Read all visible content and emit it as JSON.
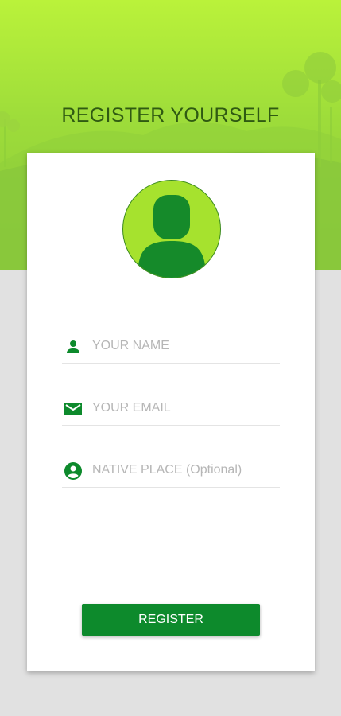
{
  "header": {
    "title": "REGISTER YOURSELF"
  },
  "form": {
    "name": {
      "placeholder": "YOUR NAME",
      "value": "",
      "icon": "person-icon"
    },
    "email": {
      "placeholder": "YOUR EMAIL",
      "value": "",
      "icon": "mail-icon"
    },
    "native_place": {
      "placeholder": "NATIVE PLACE (Optional)",
      "value": "",
      "icon": "account-circle-icon"
    }
  },
  "register_button": {
    "label": "REGISTER"
  },
  "colors": {
    "accent_green": "#0d8a2c",
    "header_top": "#baf23a",
    "header_bottom": "#8cc83c",
    "avatar_fill": "#a6e22e",
    "page_background": "#e1e1e1"
  }
}
